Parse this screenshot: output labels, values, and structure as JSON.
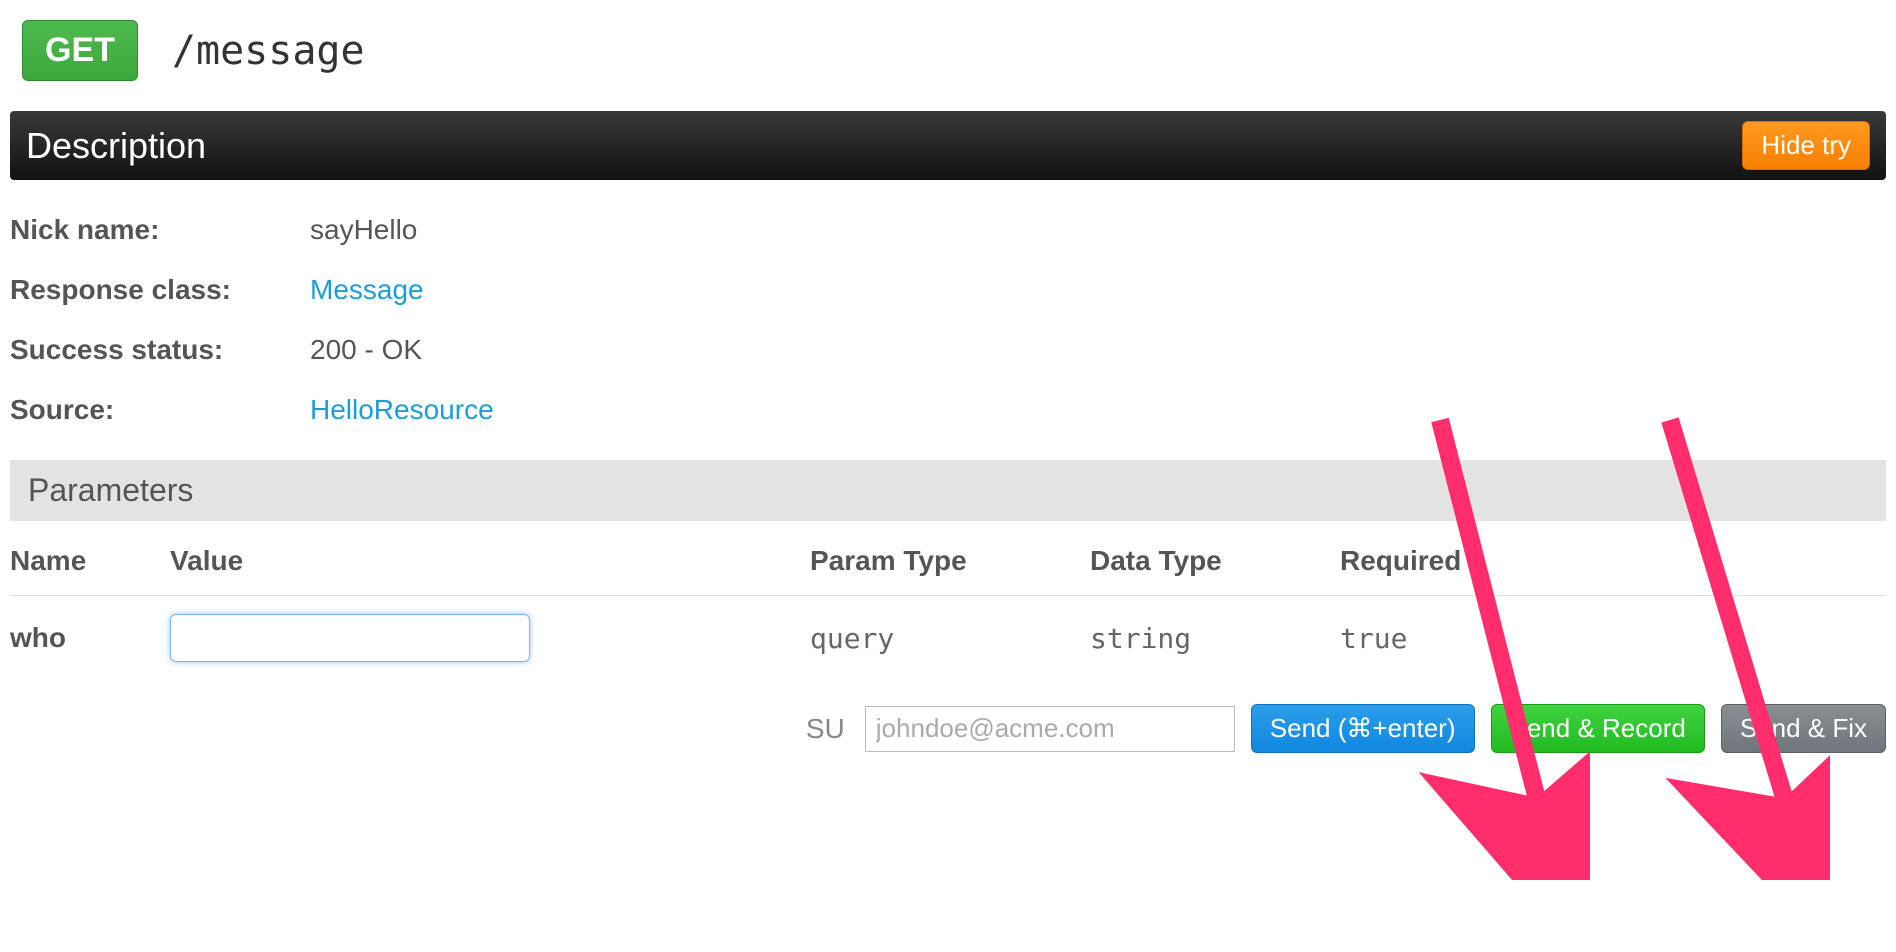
{
  "endpoint": {
    "method": "GET",
    "path": "/message"
  },
  "sections": {
    "description_title": "Description",
    "hide_try_label": "Hide try",
    "parameters_title": "Parameters"
  },
  "description": {
    "nick_name_label": "Nick name:",
    "nick_name_value": "sayHello",
    "response_class_label": "Response class:",
    "response_class_value": "Message",
    "success_status_label": "Success status:",
    "success_status_value": "200 - OK",
    "source_label": "Source:",
    "source_value": "HelloResource"
  },
  "param_headers": {
    "name": "Name",
    "value": "Value",
    "param_type": "Param Type",
    "data_type": "Data Type",
    "required": "Required"
  },
  "params": [
    {
      "name": "who",
      "value": "",
      "param_type": "query",
      "data_type": "string",
      "required": "true"
    }
  ],
  "actions": {
    "su_label": "SU",
    "su_placeholder": "johndoe@acme.com",
    "send_label": "Send (⌘+enter)",
    "send_record_label": "Send & Record",
    "send_fix_label": "Send & Fix"
  }
}
